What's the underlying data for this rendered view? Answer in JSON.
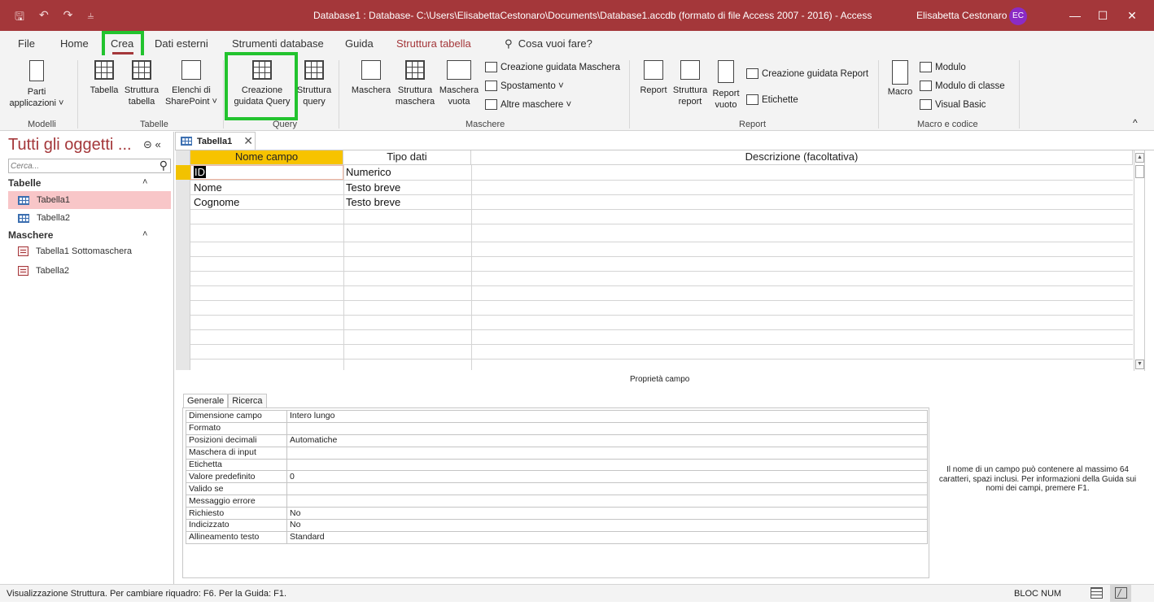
{
  "titlebar": {
    "title": "Database1 : Database- C:\\Users\\ElisabettaCestonaro\\Documents\\Database1.accdb (formato di file Access 2007 - 2016)  -  Access",
    "user": "Elisabetta Cestonaro",
    "initials": "EC",
    "quick_access": [
      "save-icon",
      "undo-icon",
      "redo-icon",
      "customize-icon"
    ],
    "window_buttons": [
      "minimize",
      "maximize",
      "close"
    ]
  },
  "tabs": [
    {
      "label": "File"
    },
    {
      "label": "Home"
    },
    {
      "label": "Crea",
      "active": true
    },
    {
      "label": "Dati esterni"
    },
    {
      "label": "Strumenti database"
    },
    {
      "label": "Guida"
    },
    {
      "label": "Struttura tabella",
      "contextual": true
    },
    {
      "label": "Cosa vuoi fare?",
      "search": true
    }
  ],
  "ribbon": {
    "groups": {
      "modelli": "Modelli",
      "tabelle": "Tabelle",
      "query": "Query",
      "maschere": "Maschere",
      "report": "Report",
      "macro": "Macro e codice"
    },
    "parti_line1": "Parti",
    "parti_line2": "applicazioni ˅",
    "tabella": "Tabella",
    "struttura_tabella_1": "Struttura",
    "struttura_tabella_2": "tabella",
    "elenchi_1": "Elenchi di",
    "elenchi_2": "SharePoint ˅",
    "creazione_query_1": "Creazione",
    "creazione_query_2": "guidata Query",
    "struttura_query_1": "Struttura",
    "struttura_query_2": "query",
    "maschera": "Maschera",
    "struttura_maschera_1": "Struttura",
    "struttura_maschera_2": "maschera",
    "maschera_vuota_1": "Maschera",
    "maschera_vuota_2": "vuota",
    "creazione_maschera": "Creazione guidata Maschera",
    "spostamento": "Spostamento ˅",
    "altre_maschere": "Altre maschere ˅",
    "report": "Report",
    "struttura_report_1": "Struttura",
    "struttura_report_2": "report",
    "report_vuoto_1": "Report",
    "report_vuoto_2": "vuoto",
    "creazione_report": "Creazione guidata Report",
    "etichette": "Etichette",
    "macro": "Macro",
    "modulo": "Modulo",
    "modulo_classe": "Modulo di classe",
    "visual_basic": "Visual Basic",
    "collapse": "^"
  },
  "nav": {
    "title": "Tutti gli oggetti ...",
    "search_placeholder": "Cerca...",
    "sections": [
      {
        "label": "Tabelle",
        "items": [
          "Tabella1",
          "Tabella2"
        ]
      },
      {
        "label": "Maschere",
        "items": [
          "Tabella1 Sottomaschera",
          "Tabella2"
        ]
      }
    ],
    "selected": "Tabella1"
  },
  "document": {
    "tab_label": "Tabella1",
    "columns": [
      "Nome campo",
      "Tipo dati",
      "Descrizione (facoltativa)"
    ],
    "rows": [
      {
        "name": "ID",
        "type": "Numerico",
        "desc": ""
      },
      {
        "name": "Nome",
        "type": "Testo breve",
        "desc": ""
      },
      {
        "name": "Cognome",
        "type": "Testo breve",
        "desc": ""
      }
    ]
  },
  "properties": {
    "title": "Proprietà campo",
    "tabs": [
      "Generale",
      "Ricerca"
    ],
    "rows": [
      {
        "k": "Dimensione campo",
        "v": "Intero lungo"
      },
      {
        "k": "Formato",
        "v": ""
      },
      {
        "k": "Posizioni decimali",
        "v": "Automatiche"
      },
      {
        "k": "Maschera di input",
        "v": ""
      },
      {
        "k": "Etichetta",
        "v": ""
      },
      {
        "k": "Valore predefinito",
        "v": "0"
      },
      {
        "k": "Valido se",
        "v": ""
      },
      {
        "k": "Messaggio errore",
        "v": ""
      },
      {
        "k": "Richiesto",
        "v": "No"
      },
      {
        "k": "Indicizzato",
        "v": "No"
      },
      {
        "k": "Allineamento testo",
        "v": "Standard"
      }
    ],
    "help": "Il nome di un campo può contenere al massimo 64 caratteri, spazi inclusi. Per informazioni della Guida sui nomi dei campi, premere F1."
  },
  "status": {
    "message": "Visualizzazione Struttura. Per cambiare riquadro: F6. Per la Guida: F1.",
    "bloc_num": "BLOC NUM"
  },
  "colors": {
    "accent": "#a4373a",
    "highlight": "#22c32e",
    "row_selector": "#f2c200",
    "nav_selected": "#f8c6c8"
  }
}
